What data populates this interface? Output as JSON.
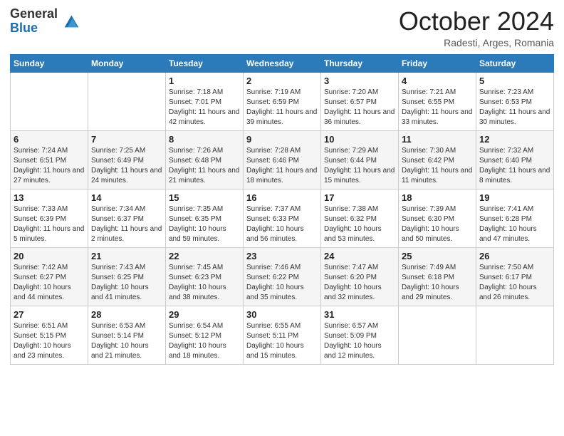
{
  "logo": {
    "general": "General",
    "blue": "Blue"
  },
  "header": {
    "month": "October 2024",
    "location": "Radesti, Arges, Romania"
  },
  "weekdays": [
    "Sunday",
    "Monday",
    "Tuesday",
    "Wednesday",
    "Thursday",
    "Friday",
    "Saturday"
  ],
  "weeks": [
    [
      {
        "day": "",
        "info": ""
      },
      {
        "day": "",
        "info": ""
      },
      {
        "day": "1",
        "info": "Sunrise: 7:18 AM\nSunset: 7:01 PM\nDaylight: 11 hours and 42 minutes."
      },
      {
        "day": "2",
        "info": "Sunrise: 7:19 AM\nSunset: 6:59 PM\nDaylight: 11 hours and 39 minutes."
      },
      {
        "day": "3",
        "info": "Sunrise: 7:20 AM\nSunset: 6:57 PM\nDaylight: 11 hours and 36 minutes."
      },
      {
        "day": "4",
        "info": "Sunrise: 7:21 AM\nSunset: 6:55 PM\nDaylight: 11 hours and 33 minutes."
      },
      {
        "day": "5",
        "info": "Sunrise: 7:23 AM\nSunset: 6:53 PM\nDaylight: 11 hours and 30 minutes."
      }
    ],
    [
      {
        "day": "6",
        "info": "Sunrise: 7:24 AM\nSunset: 6:51 PM\nDaylight: 11 hours and 27 minutes."
      },
      {
        "day": "7",
        "info": "Sunrise: 7:25 AM\nSunset: 6:49 PM\nDaylight: 11 hours and 24 minutes."
      },
      {
        "day": "8",
        "info": "Sunrise: 7:26 AM\nSunset: 6:48 PM\nDaylight: 11 hours and 21 minutes."
      },
      {
        "day": "9",
        "info": "Sunrise: 7:28 AM\nSunset: 6:46 PM\nDaylight: 11 hours and 18 minutes."
      },
      {
        "day": "10",
        "info": "Sunrise: 7:29 AM\nSunset: 6:44 PM\nDaylight: 11 hours and 15 minutes."
      },
      {
        "day": "11",
        "info": "Sunrise: 7:30 AM\nSunset: 6:42 PM\nDaylight: 11 hours and 11 minutes."
      },
      {
        "day": "12",
        "info": "Sunrise: 7:32 AM\nSunset: 6:40 PM\nDaylight: 11 hours and 8 minutes."
      }
    ],
    [
      {
        "day": "13",
        "info": "Sunrise: 7:33 AM\nSunset: 6:39 PM\nDaylight: 11 hours and 5 minutes."
      },
      {
        "day": "14",
        "info": "Sunrise: 7:34 AM\nSunset: 6:37 PM\nDaylight: 11 hours and 2 minutes."
      },
      {
        "day": "15",
        "info": "Sunrise: 7:35 AM\nSunset: 6:35 PM\nDaylight: 10 hours and 59 minutes."
      },
      {
        "day": "16",
        "info": "Sunrise: 7:37 AM\nSunset: 6:33 PM\nDaylight: 10 hours and 56 minutes."
      },
      {
        "day": "17",
        "info": "Sunrise: 7:38 AM\nSunset: 6:32 PM\nDaylight: 10 hours and 53 minutes."
      },
      {
        "day": "18",
        "info": "Sunrise: 7:39 AM\nSunset: 6:30 PM\nDaylight: 10 hours and 50 minutes."
      },
      {
        "day": "19",
        "info": "Sunrise: 7:41 AM\nSunset: 6:28 PM\nDaylight: 10 hours and 47 minutes."
      }
    ],
    [
      {
        "day": "20",
        "info": "Sunrise: 7:42 AM\nSunset: 6:27 PM\nDaylight: 10 hours and 44 minutes."
      },
      {
        "day": "21",
        "info": "Sunrise: 7:43 AM\nSunset: 6:25 PM\nDaylight: 10 hours and 41 minutes."
      },
      {
        "day": "22",
        "info": "Sunrise: 7:45 AM\nSunset: 6:23 PM\nDaylight: 10 hours and 38 minutes."
      },
      {
        "day": "23",
        "info": "Sunrise: 7:46 AM\nSunset: 6:22 PM\nDaylight: 10 hours and 35 minutes."
      },
      {
        "day": "24",
        "info": "Sunrise: 7:47 AM\nSunset: 6:20 PM\nDaylight: 10 hours and 32 minutes."
      },
      {
        "day": "25",
        "info": "Sunrise: 7:49 AM\nSunset: 6:18 PM\nDaylight: 10 hours and 29 minutes."
      },
      {
        "day": "26",
        "info": "Sunrise: 7:50 AM\nSunset: 6:17 PM\nDaylight: 10 hours and 26 minutes."
      }
    ],
    [
      {
        "day": "27",
        "info": "Sunrise: 6:51 AM\nSunset: 5:15 PM\nDaylight: 10 hours and 23 minutes."
      },
      {
        "day": "28",
        "info": "Sunrise: 6:53 AM\nSunset: 5:14 PM\nDaylight: 10 hours and 21 minutes."
      },
      {
        "day": "29",
        "info": "Sunrise: 6:54 AM\nSunset: 5:12 PM\nDaylight: 10 hours and 18 minutes."
      },
      {
        "day": "30",
        "info": "Sunrise: 6:55 AM\nSunset: 5:11 PM\nDaylight: 10 hours and 15 minutes."
      },
      {
        "day": "31",
        "info": "Sunrise: 6:57 AM\nSunset: 5:09 PM\nDaylight: 10 hours and 12 minutes."
      },
      {
        "day": "",
        "info": ""
      },
      {
        "day": "",
        "info": ""
      }
    ]
  ]
}
